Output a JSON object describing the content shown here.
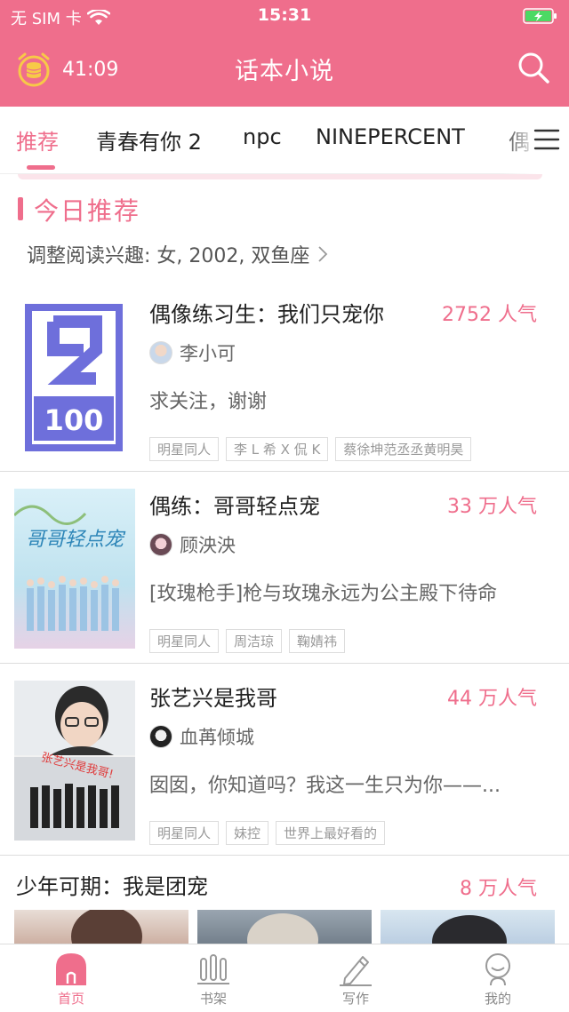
{
  "status_bar": {
    "carrier": "无 SIM 卡",
    "time": "15:31"
  },
  "header": {
    "timer": "41:09",
    "title": "话本小说"
  },
  "tabs": [
    {
      "label": "推荐",
      "active": true
    },
    {
      "label": "青春有你 2"
    },
    {
      "label": "npc"
    },
    {
      "label": "NINEPERCENT"
    },
    {
      "label": "偶"
    }
  ],
  "section": {
    "title": "今日推荐",
    "interest": "调整阅读兴趣: 女, 2002, 双鱼座"
  },
  "books": [
    {
      "title": "偶像练习生：我们只宠你",
      "popularity": "2752 人气",
      "author": "李小可",
      "desc": "求关注，谢谢",
      "tags": [
        "明星同人",
        "李 L 希 X 侃 K",
        "蔡徐坤范丞丞黄明昊"
      ],
      "cover_text": "100"
    },
    {
      "title": "偶练：哥哥轻点宠",
      "popularity": "33 万人气",
      "author": "顾泱泱",
      "desc": "[玫瑰枪手]枪与玫瑰永远为公主殿下待命",
      "tags": [
        "明星同人",
        "周洁琼",
        "鞠婧祎"
      ],
      "cover_text": "哥哥轻点宠"
    },
    {
      "title": "张艺兴是我哥",
      "popularity": "44 万人气",
      "author": "血苒倾城",
      "desc": "囡囡，你知道吗？我这一生只为你——...",
      "tags": [
        "明星同人",
        "妹控",
        "世界上最好看的"
      ],
      "cover_text": "张艺兴是我哥!"
    }
  ],
  "group": {
    "title": "少年可期：我是团宠",
    "popularity": "8 万人气"
  },
  "tabbar": [
    {
      "label": "首页",
      "icon": "home-icon",
      "active": true
    },
    {
      "label": "书架",
      "icon": "bookshelf-icon"
    },
    {
      "label": "写作",
      "icon": "pen-icon"
    },
    {
      "label": "我的",
      "icon": "profile-icon"
    }
  ],
  "colors": {
    "accent": "#EF6E8C",
    "battery": "#4CD964"
  }
}
